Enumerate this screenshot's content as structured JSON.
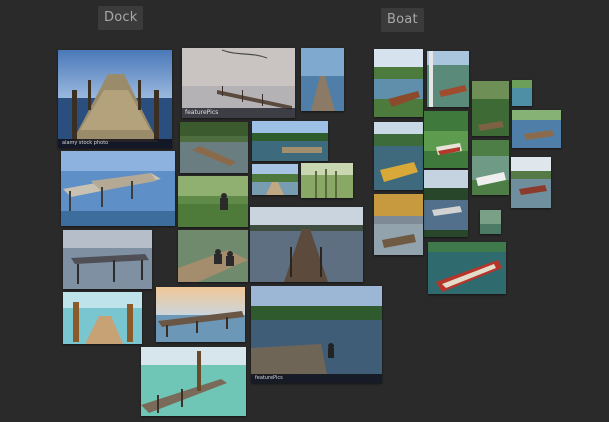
{
  "groups": {
    "dock_label": "Dock",
    "boat_label": "Boat"
  },
  "credits": {
    "alamy": "alamy stock photo",
    "featurepics": "featurePics",
    "dock_photo_tag": "featurePics"
  },
  "colors": {
    "background": "#2a2a2a",
    "label_bg": "#3b3b3b",
    "label_text": "#a8a8a8"
  }
}
